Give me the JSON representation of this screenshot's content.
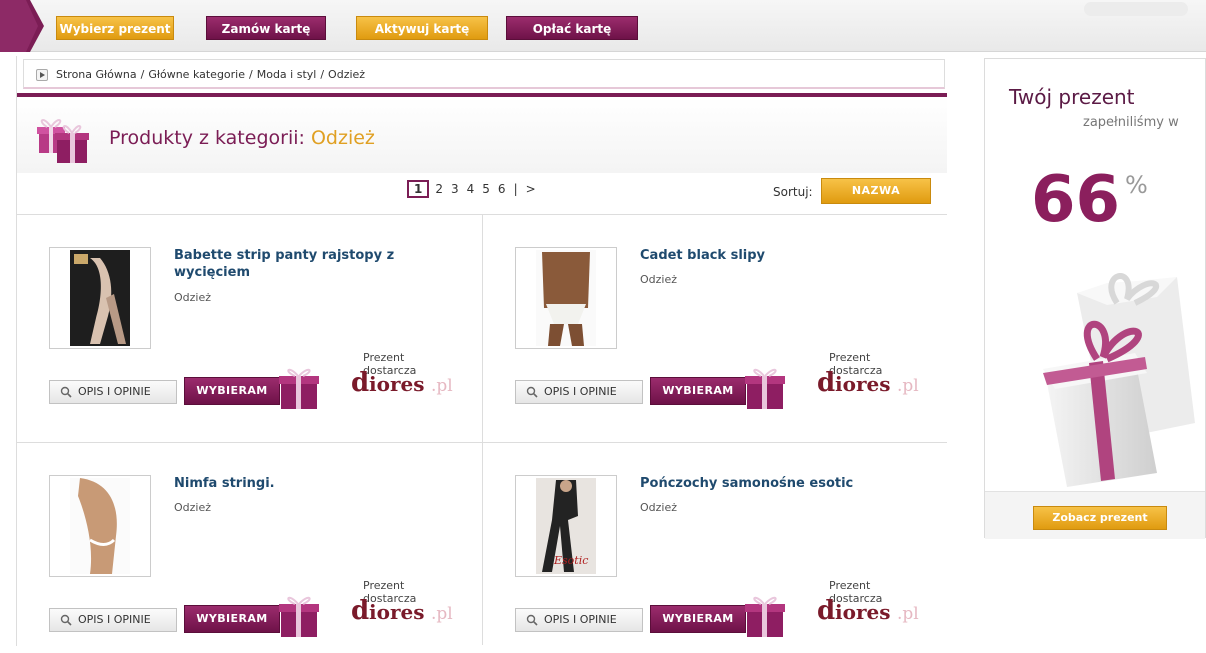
{
  "steps": [
    {
      "label": "Wybierz prezent",
      "style": "orange"
    },
    {
      "label": "Zamów kartę",
      "style": "purple"
    },
    {
      "label": "Aktywuj kartę",
      "style": "orange"
    },
    {
      "label": "Opłać kartę",
      "style": "purple"
    }
  ],
  "breadcrumb": {
    "items": [
      "Strona Główna",
      "Główne kategorie",
      "Moda i styl",
      "Odzież"
    ],
    "separator": "/"
  },
  "category": {
    "title_prefix": "Produkty z kategorii:",
    "name": "Odzież"
  },
  "pagination": {
    "current": "1",
    "pages": [
      "2",
      "3",
      "4",
      "5",
      "6"
    ],
    "divider": "|",
    "next": ">"
  },
  "sort": {
    "label": "Sortuj:",
    "button": "NAZWA"
  },
  "products": [
    {
      "name": "Babette strip panty rajstopy z wycięciem",
      "category": "Odzież",
      "supplier_label": "Prezent dostarcza",
      "supplier": "diores.pl",
      "opis": "OPIS I OPINIE",
      "wybieram": "WYBIERAM"
    },
    {
      "name": "Cadet black slipy",
      "category": "Odzież",
      "supplier_label": "Prezent dostarcza",
      "supplier": "diores.pl",
      "opis": "OPIS I OPINIE",
      "wybieram": "WYBIERAM"
    },
    {
      "name": "Nimfa stringi.",
      "category": "Odzież",
      "supplier_label": "Prezent dostarcza",
      "supplier": "diores.pl",
      "opis": "OPIS I OPINIE",
      "wybieram": "WYBIERAM"
    },
    {
      "name": "Pończochy samonośne esotic",
      "category": "Odzież",
      "supplier_label": "Prezent dostarcza",
      "supplier": "diores.pl",
      "opis": "OPIS I OPINIE",
      "wybieram": "WYBIERAM"
    }
  ],
  "ad": {
    "title": "Twój prezent",
    "subtitle": "zapełniliśmy w",
    "percent": "66",
    "percent_sign": "%",
    "button": "Zobacz prezent"
  },
  "colors": {
    "brand_purple": "#7b1d55",
    "accent_orange": "#e09b10",
    "link_blue": "#1f4a6e"
  }
}
